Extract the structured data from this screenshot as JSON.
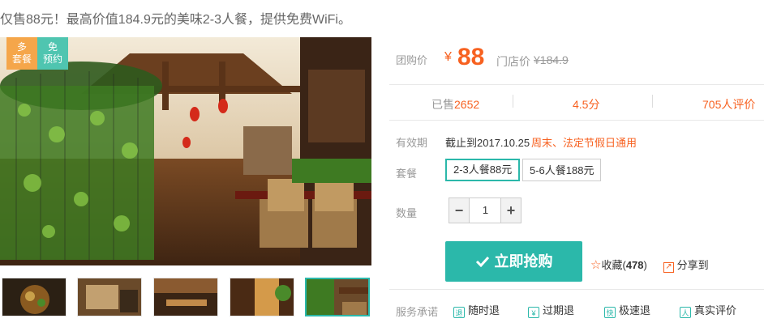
{
  "title_fragment": "",
  "subtitle": "仅售88元！最高价值184.9元的美味2-3人餐，提供免费WiFi。",
  "badges": {
    "set_meal": "多\n套餐",
    "no_booking": "免\n预约"
  },
  "price": {
    "label": "团购价",
    "currency": "¥",
    "value": "88",
    "store_label": "门店价",
    "store_value": "¥184.9"
  },
  "stats": {
    "sold_prefix": "已售",
    "sold_count": "2652",
    "rating": "4.5",
    "rating_suffix": "分",
    "reviews_count": "705",
    "reviews_suffix": "人评价"
  },
  "validity": {
    "label": "有效期",
    "date": "截止到2017.10.25",
    "note": "周末、法定节假日通用"
  },
  "package": {
    "label": "套餐",
    "options": [
      "2-3人餐88元",
      "5-6人餐188元"
    ],
    "selected": "2-3人餐88元"
  },
  "quantity": {
    "label": "数量",
    "minus": "−",
    "plus": "+",
    "value": "1"
  },
  "actions": {
    "buy": "立即抢购",
    "favorite_label": "收藏",
    "favorite_count": "478",
    "share": "分享到"
  },
  "service": {
    "label": "服务承诺",
    "items": [
      "随时退",
      "过期退",
      "极速退",
      "真实评价"
    ],
    "icons": [
      "refund-anytime-icon",
      "expired-refund-icon",
      "fast-refund-icon",
      "real-review-icon"
    ]
  },
  "colors": {
    "accent_orange": "#f76120",
    "accent_teal": "#2bb8aa"
  }
}
